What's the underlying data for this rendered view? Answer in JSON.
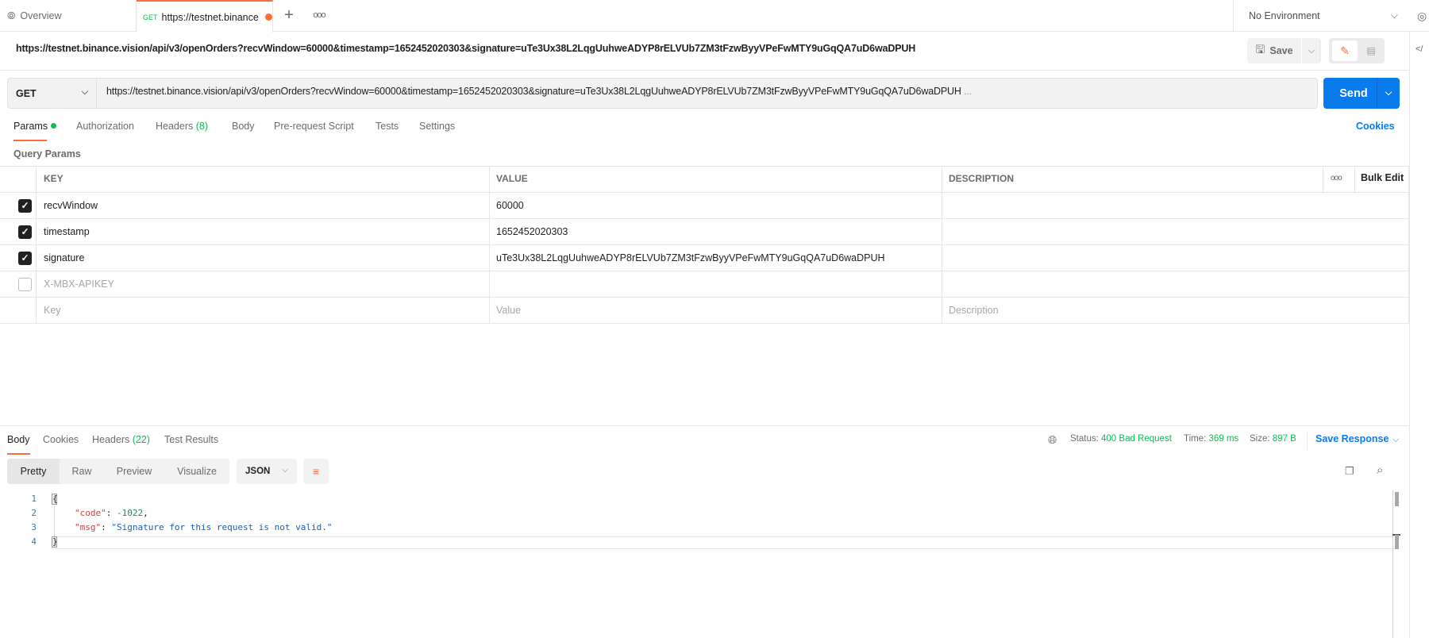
{
  "tabs": {
    "overview_label": "Overview",
    "active_method": "GET",
    "active_title": "https://testnet.binance",
    "environment": "No Environment"
  },
  "request": {
    "title": "https://testnet.binance.vision/api/v3/openOrders?recvWindow=60000&timestamp=1652452020303&signature=uTe3Ux38L2LqgUuhweADYP8rELVUb7ZM3tFzwByyVPeFwMTY9uGqQA7uD6waDPUH",
    "save_label": "Save",
    "method": "GET",
    "url": "https://testnet.binance.vision/api/v3/openOrders?recvWindow=60000&timestamp=1652452020303&signature=uTe3Ux38L2LqgUuhweADYP8rELVUb7ZM3tFzwByyVPeFwMTY9uGqQA7uD6waDPUH",
    "url_ellipsis": "...",
    "send_label": "Send",
    "tabs": [
      {
        "label": "Params",
        "count": ""
      },
      {
        "label": "Authorization",
        "count": ""
      },
      {
        "label": "Headers",
        "count": "(8)"
      },
      {
        "label": "Body",
        "count": ""
      },
      {
        "label": "Pre-request Script",
        "count": ""
      },
      {
        "label": "Tests",
        "count": ""
      },
      {
        "label": "Settings",
        "count": ""
      }
    ],
    "cookies_label": "Cookies",
    "query_params_label": "Query Params"
  },
  "params_table": {
    "headers": {
      "key": "KEY",
      "value": "VALUE",
      "description": "DESCRIPTION",
      "bulk_edit": "Bulk Edit"
    },
    "rows": [
      {
        "checked": true,
        "key": "recvWindow",
        "value": "60000",
        "description": ""
      },
      {
        "checked": true,
        "key": "timestamp",
        "value": "1652452020303",
        "description": ""
      },
      {
        "checked": true,
        "key": "signature",
        "value": "uTe3Ux38L2LqgUuhweADYP8rELVUb7ZM3tFzwByyVPeFwMTY9uGqQA7uD6waDPUH",
        "description": ""
      },
      {
        "checked": false,
        "key": "X-MBX-APIKEY",
        "value": "",
        "description": ""
      }
    ],
    "placeholders": {
      "key": "Key",
      "value": "Value",
      "description": "Description"
    }
  },
  "response": {
    "tabs": [
      {
        "label": "Body",
        "count": ""
      },
      {
        "label": "Cookies",
        "count": ""
      },
      {
        "label": "Headers",
        "count": "(22)"
      },
      {
        "label": "Test Results",
        "count": ""
      }
    ],
    "status_label": "Status:",
    "status_value": "400 Bad Request",
    "time_label": "Time:",
    "time_value": "369 ms",
    "size_label": "Size:",
    "size_value": "897 B",
    "save_response_label": "Save Response",
    "views": [
      "Pretty",
      "Raw",
      "Preview",
      "Visualize"
    ],
    "format": "JSON",
    "body_lines": [
      {
        "num": "1",
        "text": "{"
      },
      {
        "num": "2",
        "key": "\"code\"",
        "sep": ": ",
        "value": "-1022",
        "end": ","
      },
      {
        "num": "3",
        "key": "\"msg\"",
        "sep": ": ",
        "value": "\"Signature for this request is not valid.\"",
        "end": ""
      },
      {
        "num": "4",
        "text": "}"
      }
    ]
  },
  "colors": {
    "accent_orange": "#ff6c37",
    "send_blue": "#097bed",
    "success_green": "#0cbb52"
  }
}
